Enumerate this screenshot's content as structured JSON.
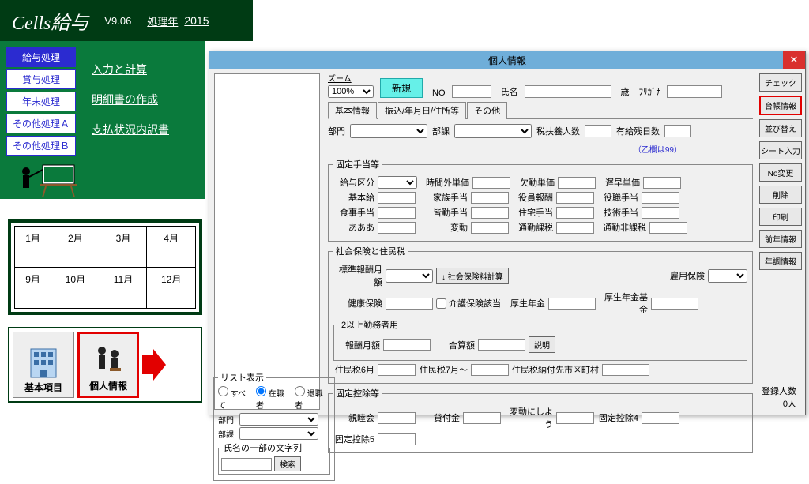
{
  "app": {
    "title": "Cells給与",
    "version": "V9.06",
    "proc_year_label": "処理年",
    "proc_year": "2015"
  },
  "sidebar": {
    "items": [
      {
        "label": "給与処理",
        "active": true
      },
      {
        "label": "賞与処理"
      },
      {
        "label": "年末処理"
      },
      {
        "label": "その他処理Ａ"
      },
      {
        "label": "その他処理Ｂ"
      }
    ]
  },
  "board_links": [
    "入力と計算",
    "明細書の作成",
    "支払状況内訳書"
  ],
  "months_row1": [
    "1月",
    "2月",
    "3月",
    "4月"
  ],
  "months_row2": [
    "9月",
    "10月",
    "11月",
    "12月"
  ],
  "toolbar": {
    "basic": "基本項目",
    "personal": "個人情報"
  },
  "window": {
    "title": "個人情報",
    "zoom_label": "ズーム",
    "zoom_value": "100%",
    "new_btn": "新規",
    "no_label": "NO",
    "name_label": "氏名",
    "age_label": "歳",
    "kana_label": "ﾌﾘｶﾞﾅ",
    "tabs": [
      "基本情報",
      "振込/年月日/住所等",
      "その他"
    ],
    "dept_label": "部門",
    "section_label": "部課",
    "dependents_label": "税扶養人数",
    "paid_leave_label": "有給残日数",
    "note_otsu": "（乙欄は99）",
    "fixed_allow": {
      "legend": "固定手当等",
      "pay_category": "給与区分",
      "hourly_ot": "時間外単価",
      "absence": "欠勤単価",
      "late": "遅早単価",
      "base": "基本給",
      "family": "家族手当",
      "position": "役員報酬",
      "commute": "役職手当",
      "meal": "食事手当",
      "diligence": "皆勤手当",
      "housing": "住宅手当",
      "skill": "技術手当",
      "row3a": "あああ",
      "row3b": "変動",
      "row3c": "通勤課税",
      "row3d": "通勤非課税"
    },
    "social": {
      "legend": "社会保険と住民税",
      "std_monthly": "標準報酬月額",
      "calc_btn": "↓ 社会保険料計算",
      "emp_ins": "雇用保険",
      "health": "健康保険",
      "care_chk": "介護保険該当",
      "welfare": "厚生年金",
      "fund": "厚生年金基金",
      "multi_legend": "2以上勤務者用",
      "rem_monthly": "報酬月額",
      "total": "合算額",
      "explain": "説明",
      "res_tax6": "住民税6月",
      "res_tax7": "住民税7月～",
      "res_paycity": "住民税納付先市区町村"
    },
    "deduct": {
      "legend": "固定控除等",
      "d1": "親睦会",
      "d2": "貸付金",
      "d3": "変動にしよう",
      "d4": "固定控除4",
      "d5": "固定控除5"
    },
    "right_btns": [
      "チェック",
      "台帳情報",
      "並び替え",
      "シート入力",
      "No変更",
      "削除",
      "印刷",
      "前年情報",
      "年調情報"
    ],
    "count_label": "登録人数",
    "count_value": "0人"
  },
  "filter": {
    "legend": "リスト表示",
    "radios": [
      "すべて",
      "在職者",
      "退職者"
    ],
    "dept": "部門",
    "sect": "部課",
    "name_legend": "氏名の一部の文字列",
    "search": "検索"
  }
}
